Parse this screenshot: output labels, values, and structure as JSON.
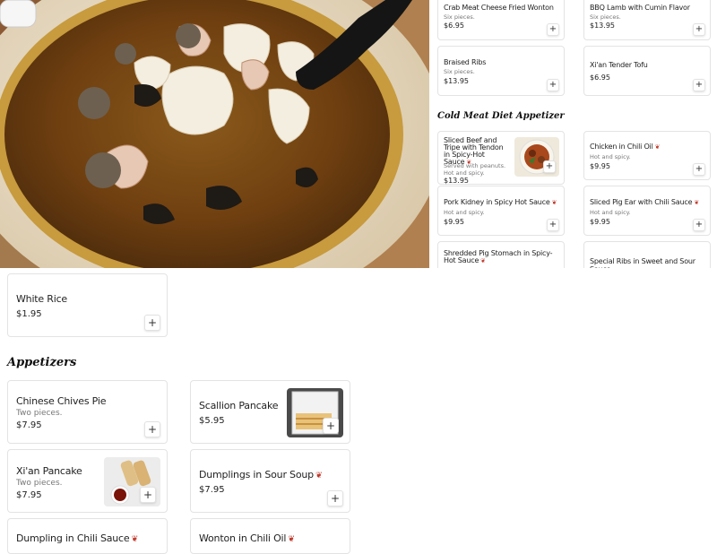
{
  "hero": {
    "image": "soup-photo"
  },
  "right_column": {
    "top_cards": [
      {
        "title": "Crab Meat Cheese Fried Wonton",
        "desc": "Six pieces.",
        "price": "$6.95"
      },
      {
        "title": "BBQ Lamb with Cumin Flavor",
        "desc": "Six pieces.",
        "price": "$13.95"
      },
      {
        "title": "Braised Ribs",
        "desc": "Six pieces.",
        "price": "$13.95"
      },
      {
        "title": "Xi'an Tender Tofu",
        "desc": "",
        "price": "$6.95"
      }
    ],
    "section_title": "Cold Meat Diet Appetizer",
    "cold_cards": [
      {
        "title": "Sliced Beef and Tripe with Tendon in Spicy-Hot Sauce",
        "desc": "Served with peanuts. Hot and spicy.",
        "price": "$13.95"
      },
      {
        "title": "Chicken in Chili Oil",
        "desc": "Hot and spicy.",
        "price": "$9.95"
      },
      {
        "title": "Pork Kidney in Spicy Hot Sauce",
        "desc": "Hot and spicy.",
        "price": "$9.95"
      },
      {
        "title": "Sliced Pig Ear with Chili Sauce",
        "desc": "Hot and spicy.",
        "price": "$9.95"
      },
      {
        "title": "Shredded Pig Stomach in Spicy-Hot Sauce",
        "desc": "",
        "price": ""
      },
      {
        "title": "Special Ribs in Sweet and Sour Sauce",
        "desc": "",
        "price": ""
      }
    ]
  },
  "white_rice": {
    "title": "White Rice",
    "price": "$1.95"
  },
  "appetizers": {
    "section_title": "Appetizers",
    "cards": [
      {
        "title": "Chinese Chives Pie",
        "desc": "Two pieces.",
        "price": "$7.95"
      },
      {
        "title": "Scallion Pancake",
        "desc": "",
        "price": "$5.95"
      },
      {
        "title": "Xi'an Pancake",
        "desc": "Two pieces.",
        "price": "$7.95"
      },
      {
        "title": "Dumplings in Sour Soup",
        "desc": "",
        "price": "$7.95"
      },
      {
        "title": "Dumpling in Chili Sauce",
        "desc": "",
        "price": ""
      },
      {
        "title": "Wonton in Chili Oil",
        "desc": "",
        "price": ""
      }
    ]
  },
  "icons": {
    "add": "+",
    "chili": "❦"
  },
  "colors": {
    "chili_red": "#c0392b",
    "border": "#e3e3e3"
  }
}
